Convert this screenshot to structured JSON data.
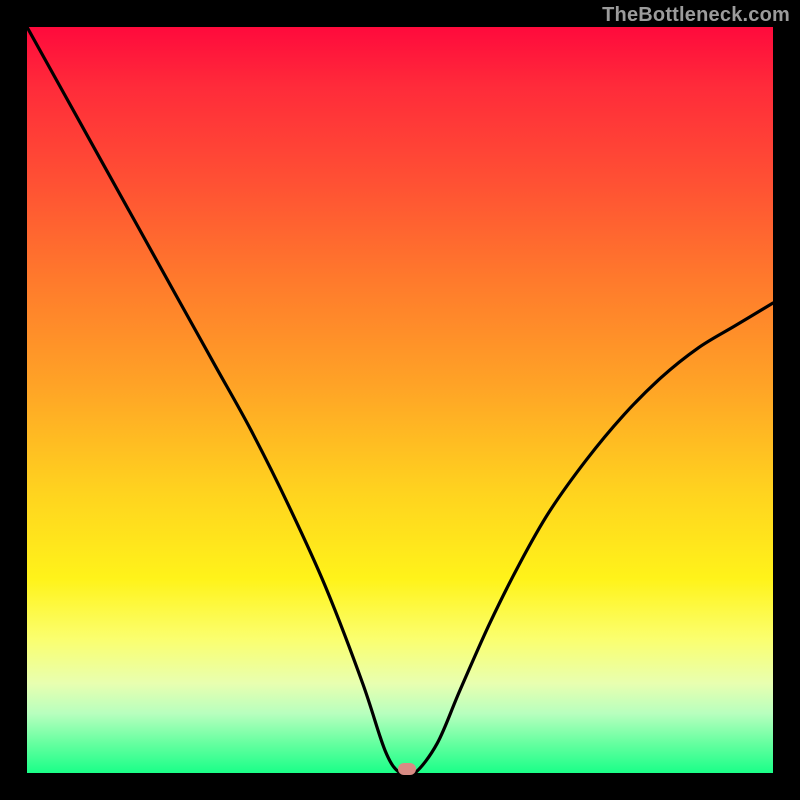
{
  "watermark": "TheBottleneck.com",
  "chart_data": {
    "type": "line",
    "title": "",
    "xlabel": "",
    "ylabel": "",
    "xlim": [
      0,
      100
    ],
    "ylim": [
      0,
      100
    ],
    "grid": false,
    "legend": false,
    "series": [
      {
        "name": "bottleneck-curve",
        "x": [
          0,
          5,
          10,
          15,
          20,
          25,
          30,
          35,
          40,
          45,
          48,
          50,
          52,
          55,
          58,
          62,
          66,
          70,
          75,
          80,
          85,
          90,
          95,
          100
        ],
        "values": [
          100,
          91,
          82,
          73,
          64,
          55,
          46,
          36,
          25,
          12,
          3,
          0,
          0,
          4,
          11,
          20,
          28,
          35,
          42,
          48,
          53,
          57,
          60,
          63
        ]
      }
    ],
    "marker": {
      "x": 51,
      "y": 0.6,
      "color": "#d88b84"
    },
    "gradient_stops": [
      {
        "pos": 0,
        "color": "#ff0a3c"
      },
      {
        "pos": 8,
        "color": "#ff2b3a"
      },
      {
        "pos": 20,
        "color": "#ff4e34"
      },
      {
        "pos": 34,
        "color": "#ff7a2c"
      },
      {
        "pos": 48,
        "color": "#ffa326"
      },
      {
        "pos": 62,
        "color": "#ffd21f"
      },
      {
        "pos": 74,
        "color": "#fff31a"
      },
      {
        "pos": 82,
        "color": "#fbff6e"
      },
      {
        "pos": 88,
        "color": "#e8ffb0"
      },
      {
        "pos": 92,
        "color": "#b8ffbe"
      },
      {
        "pos": 96,
        "color": "#66ffa0"
      },
      {
        "pos": 100,
        "color": "#1aff88"
      }
    ]
  }
}
